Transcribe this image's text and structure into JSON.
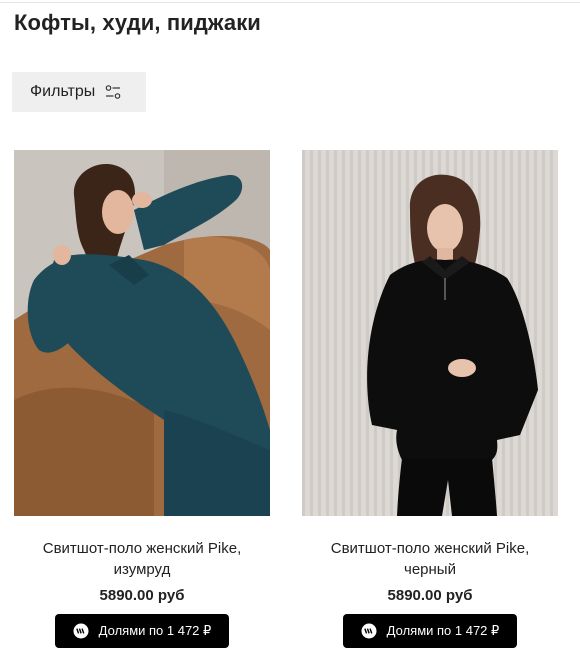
{
  "page": {
    "title": "Кофты, худи, пиджаки"
  },
  "filters": {
    "label": "Фильтры",
    "icon": "filter-sliders-icon"
  },
  "products": [
    {
      "name": "Свитшот-поло женский Pike, изумруд",
      "price": "5890.00 руб",
      "split_label": "Долями по 1 472 ₽",
      "image_colors": {
        "garment": "#1f4a58",
        "background": "#c9c4be",
        "sofa": "#a06a40"
      }
    },
    {
      "name": "Свитшот-поло женский Pike, черный",
      "price": "5890.00 руб",
      "split_label": "Долями по 1 472 ₽",
      "image_colors": {
        "garment": "#0d0d0d",
        "background": "#d8d4d0"
      }
    }
  ],
  "colors": {
    "accent": "#000000",
    "button_bg": "#efefef",
    "text": "#222222"
  }
}
